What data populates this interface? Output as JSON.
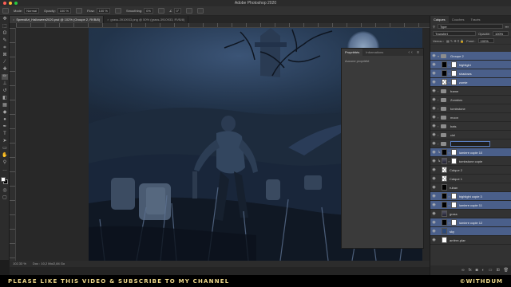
{
  "app": {
    "title": "Adobe Photoshop 2020"
  },
  "options_bar": {
    "mode_label": "Mode:",
    "mode_value": "Normal",
    "opacity_label": "Opacity:",
    "opacity_value": "100 %",
    "flow_label": "Flow:",
    "flow_value": "100 %",
    "smoothing_label": "Smoothing:",
    "smoothing_value": "0%",
    "angle_value": "0°"
  },
  "doc_tabs": [
    {
      "label": "SpeedArt_Halloween2020.psd @ 102% (Groupe 2, RVB/8)",
      "active": true
    },
    {
      "label": "grass-3910933.png @ 50% (grass-3910933, RVB/8)",
      "active": false
    }
  ],
  "status": {
    "zoom": "102.33 %",
    "doc": "Doc : 10,2 Mo/2,84 Go"
  },
  "properties_panel": {
    "tab_properties": "Propriétés",
    "tab_information": "Informations",
    "body_text": "Aucune propriété"
  },
  "layers_panel": {
    "tabs": [
      "Calques",
      "Couches",
      "Tracés"
    ],
    "kind_value": "Type",
    "blend_value": "Transfert",
    "opacity_label": "Opacité:",
    "opacity_value": "100%",
    "lock_label": "Verrou :",
    "fill_label": "Fond :",
    "fill_value": "100%",
    "layers": [
      {
        "name": "Groupe 2",
        "kind": "group",
        "selected": true
      },
      {
        "name": "highlight",
        "kind": "pixel",
        "selected": true
      },
      {
        "name": "shadows",
        "kind": "pixel",
        "selected": true
      },
      {
        "name": "zomie",
        "kind": "pixel",
        "selected": true
      },
      {
        "name": "frame",
        "kind": "group",
        "selected": false
      },
      {
        "name": "Zombies",
        "kind": "group",
        "selected": false
      },
      {
        "name": "tombstone",
        "kind": "group",
        "selected": false
      },
      {
        "name": "moon",
        "kind": "group",
        "selected": false
      },
      {
        "name": "bats",
        "kind": "group",
        "selected": false
      },
      {
        "name": "ciel",
        "kind": "group",
        "selected": false
      },
      {
        "name": "",
        "kind": "editing",
        "selected": false
      },
      {
        "name": "lumiere copie 10",
        "kind": "pixel",
        "selected": true
      },
      {
        "name": "tombstone copie",
        "kind": "pixel",
        "selected": false
      },
      {
        "name": "Calque 2",
        "kind": "pixel",
        "selected": false
      },
      {
        "name": "Calque 1",
        "kind": "pixel",
        "selected": false
      },
      {
        "name": "ruban",
        "kind": "pixel",
        "selected": false
      },
      {
        "name": "highlight copie 3",
        "kind": "pixel",
        "selected": true
      },
      {
        "name": "lumiere copie 11",
        "kind": "pixel",
        "selected": true
      },
      {
        "name": "grass",
        "kind": "pixel",
        "selected": false
      },
      {
        "name": "lumiere copie 12",
        "kind": "pixel",
        "selected": true
      },
      {
        "name": "sky",
        "kind": "pixel",
        "selected": true
      },
      {
        "name": "arrière-plan",
        "kind": "pixel",
        "selected": false
      }
    ]
  },
  "banner": {
    "text": "PLEASE LIKE THIS VIDEO & SUBSCRIBE TO MY CHANNEL",
    "handle": "©WITHDUM"
  },
  "colors": {
    "accent": "#4a5f8a",
    "banner_text": "#f0d98a"
  }
}
